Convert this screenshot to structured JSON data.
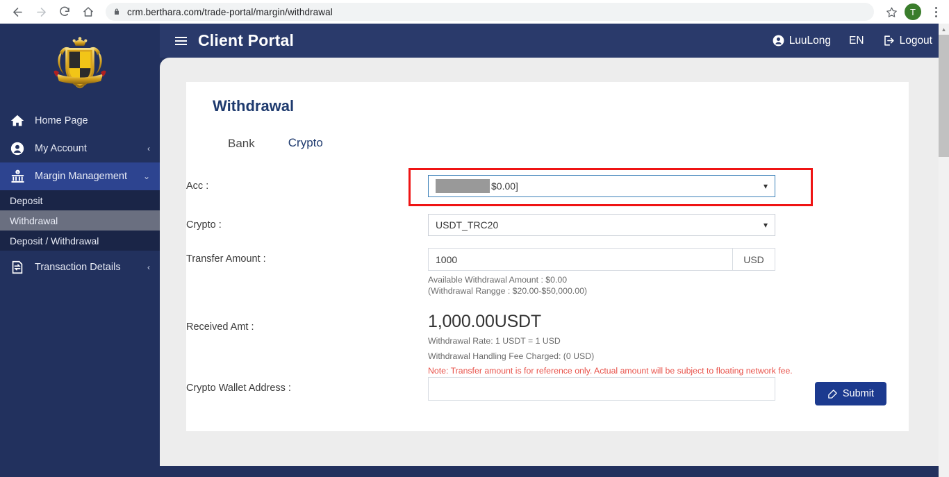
{
  "browser": {
    "url": "crm.berthara.com/trade-portal/margin/withdrawal",
    "back_icon": "back-arrow-icon",
    "forward_icon": "forward-arrow-icon",
    "reload_icon": "reload-icon",
    "home_icon": "home-icon",
    "lock_icon": "lock-icon",
    "bookmark_icon": "star-icon",
    "profile_initial": "T",
    "menu_icon": "three-dot-menu-icon"
  },
  "sidebar": {
    "logo_alt": "berthara-crest-logo",
    "items": [
      {
        "label": "Home Page",
        "icon": "home-icon",
        "chevron": "",
        "active": false
      },
      {
        "label": "My Account",
        "icon": "user-circle-icon",
        "chevron": "‹",
        "active": false
      },
      {
        "label": "Margin Management",
        "icon": "bank-icon",
        "chevron": "⌄",
        "active": true
      }
    ],
    "submenu": [
      {
        "label": "Deposit",
        "selected": false
      },
      {
        "label": "Withdrawal",
        "selected": true
      },
      {
        "label": "Deposit / Withdrawal",
        "selected": false
      }
    ],
    "items_after": [
      {
        "label": "Transaction Details",
        "icon": "transfer-doc-icon",
        "chevron": "‹",
        "active": false
      }
    ]
  },
  "topbar": {
    "menu_toggle_icon": "hamburger-icon",
    "title": "Client Portal",
    "user_icon": "user-circle-icon",
    "user_name": "LuuLong",
    "language": "EN",
    "logout_icon": "logout-icon",
    "logout_label": "Logout"
  },
  "page": {
    "title": "Withdrawal",
    "tabs": [
      {
        "label": "Bank",
        "active": false
      },
      {
        "label": "Crypto",
        "active": true
      }
    ]
  },
  "form": {
    "acc": {
      "label": "Acc :",
      "value_suffix": "$0.00]",
      "redacted": true,
      "caret_icon": "chevron-down-icon"
    },
    "crypto": {
      "label": "Crypto :",
      "value": "USDT_TRC20",
      "caret_icon": "chevron-down-icon"
    },
    "transfer_amount": {
      "label": "Transfer Amount :",
      "value": "1000",
      "unit": "USD",
      "hint_line1": "Available Withdrawal Amount :  $0.00",
      "hint_line2": "(Withdrawal Rangge :  $20.00-$50,000.00)"
    },
    "received": {
      "label": "Received Amt :",
      "value": "1,000.00USDT",
      "rate_line": "Withdrawal Rate: 1 USDT = 1 USD",
      "fee_line": "Withdrawal Handling Fee Charged: (0 USD)",
      "note_line": "Note: Transfer amount is for reference only. Actual amount will be subject to floating network fee."
    },
    "wallet": {
      "label": "Crypto Wallet Address :",
      "value": "",
      "placeholder": ""
    },
    "submit": {
      "label": "Submit",
      "icon": "edit-pencil-icon"
    }
  },
  "colors": {
    "sidebar_navy": "#22315e",
    "topbar_navy": "#2a3a6b",
    "submenu_navy": "#1a2547",
    "active_blue": "#2d4490",
    "selected_gray": "#6a6f80",
    "accent_blue": "#1c3a8f",
    "highlight_red": "#ef1414",
    "note_red": "#e8524a",
    "title_blue": "#1e3a6e",
    "avatar_green": "#3a7d2c"
  }
}
